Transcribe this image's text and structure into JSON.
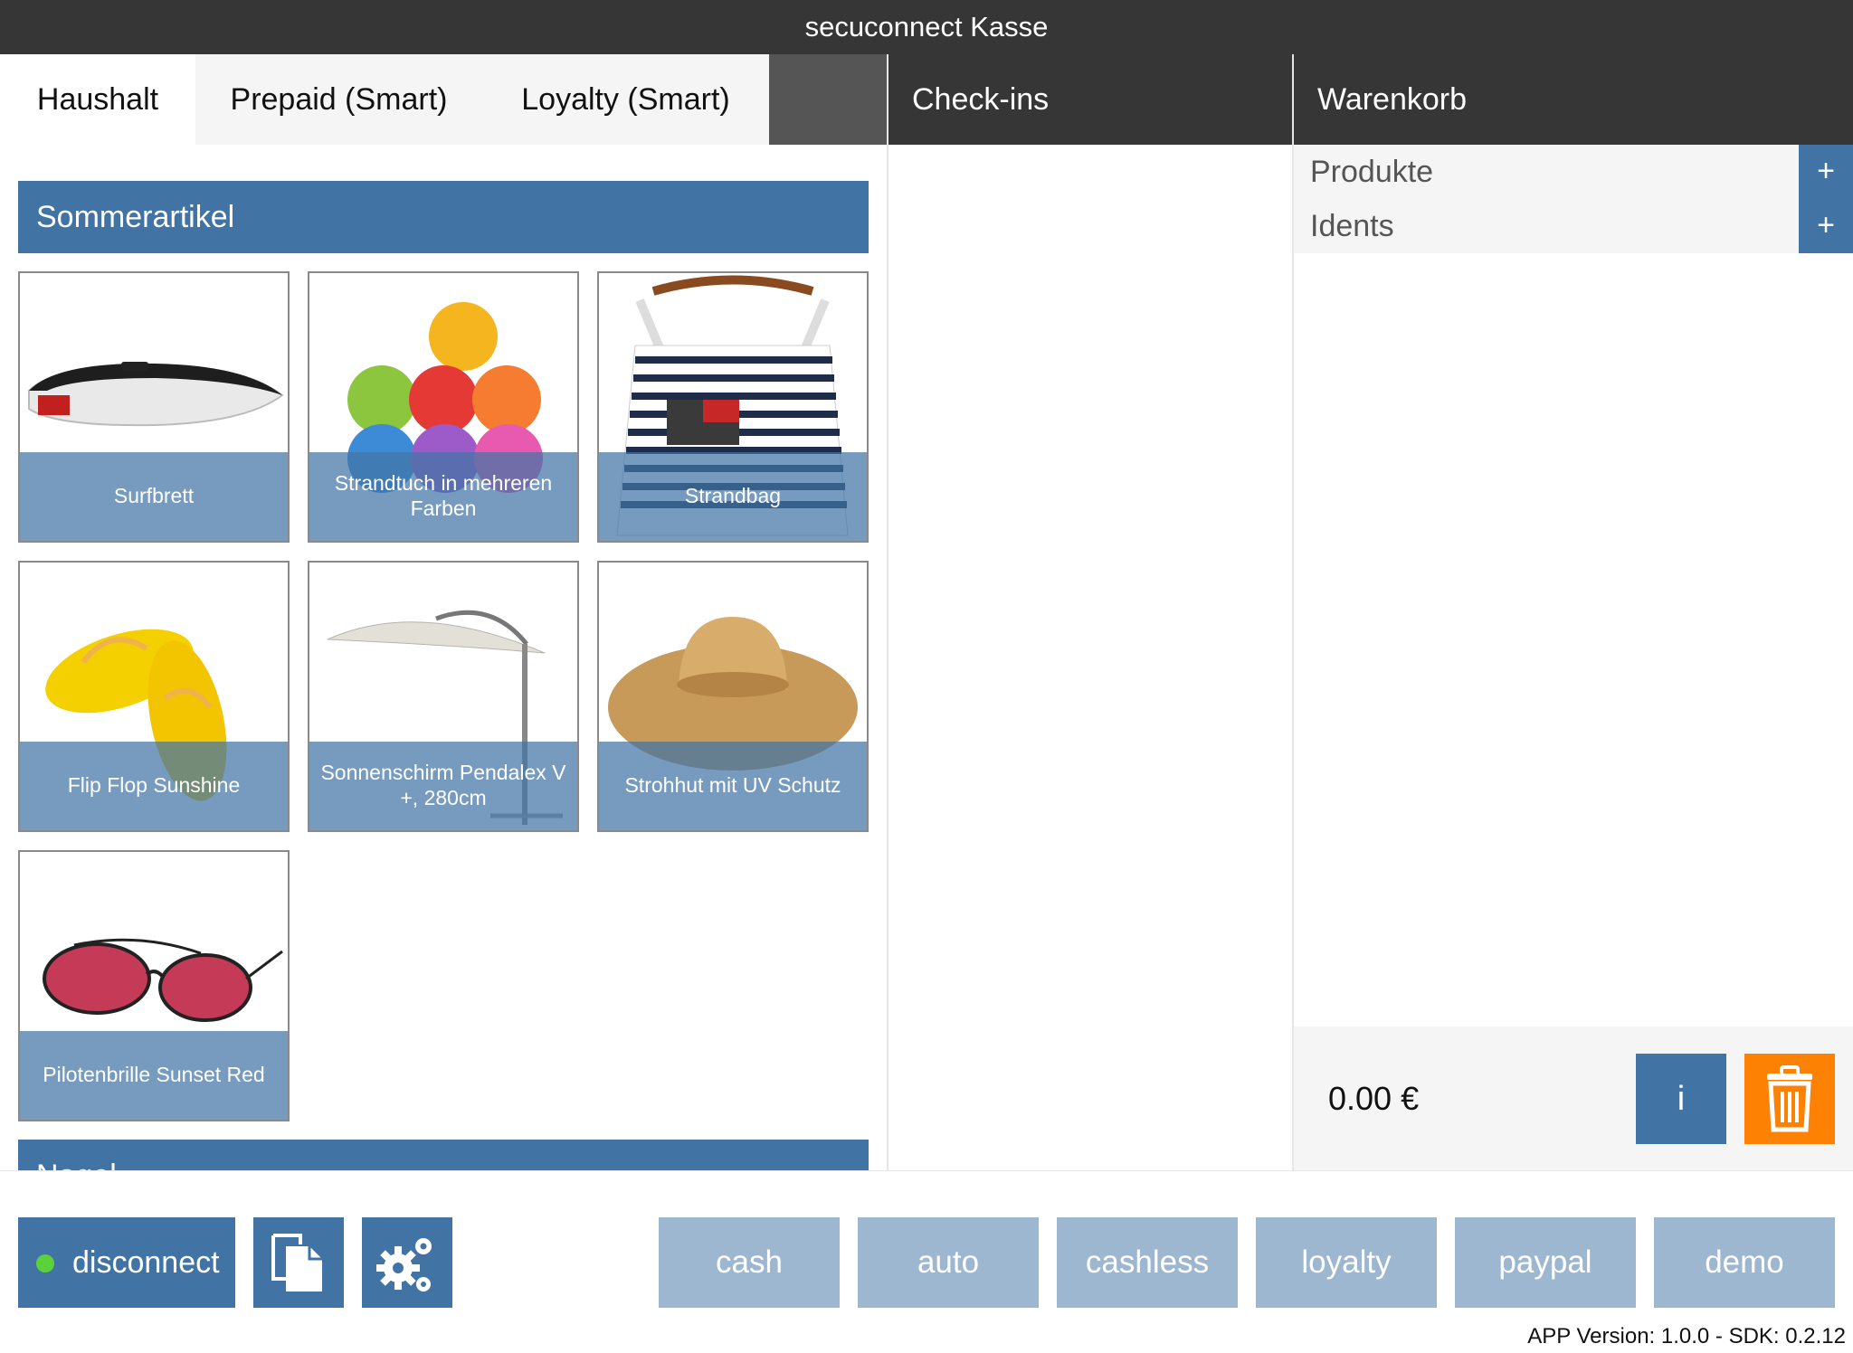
{
  "app": {
    "title": "secuconnect Kasse"
  },
  "tabs": [
    {
      "label": "Haushalt",
      "active": true
    },
    {
      "label": "Prepaid (Smart)",
      "active": false
    },
    {
      "label": "Loyalty (Smart)",
      "active": false
    }
  ],
  "checkins": {
    "title": "Check-ins"
  },
  "cart": {
    "title": "Warenkorb",
    "rows": [
      {
        "label": "Produkte",
        "action": "+"
      },
      {
        "label": "Idents",
        "action": "+"
      }
    ],
    "total": "0.00 €",
    "info_label": "i"
  },
  "catalog": {
    "section": "Sommerartikel",
    "next_section": "Nagel",
    "products": [
      {
        "name": "Surfbrett",
        "icon": "surfboard-image"
      },
      {
        "name": "Strandtuch in mehreren Farben",
        "icon": "towels-image"
      },
      {
        "name": "Strandbag",
        "icon": "beach-bag-image"
      },
      {
        "name": "Flip Flop Sunshine",
        "icon": "flip-flops-image"
      },
      {
        "name": "Sonnenschirm Pendalex V +, 280cm",
        "icon": "parasol-image"
      },
      {
        "name": "Strohhut mit UV Schutz",
        "icon": "straw-hat-image"
      },
      {
        "name": "Pilotenbrille Sunset Red",
        "icon": "sunglasses-image"
      }
    ]
  },
  "footer": {
    "disconnect_label": "disconnect",
    "connection_status_color": "#5dd13a",
    "payment_methods": [
      "cash",
      "auto",
      "cashless",
      "loyalty",
      "paypal",
      "demo"
    ],
    "version": "APP Version: 1.0.0 - SDK: 0.2.12"
  },
  "colors": {
    "header": "#363636",
    "accent": "#4174a5",
    "payment_button": "#9db7d1",
    "delete": "#fd8204"
  }
}
